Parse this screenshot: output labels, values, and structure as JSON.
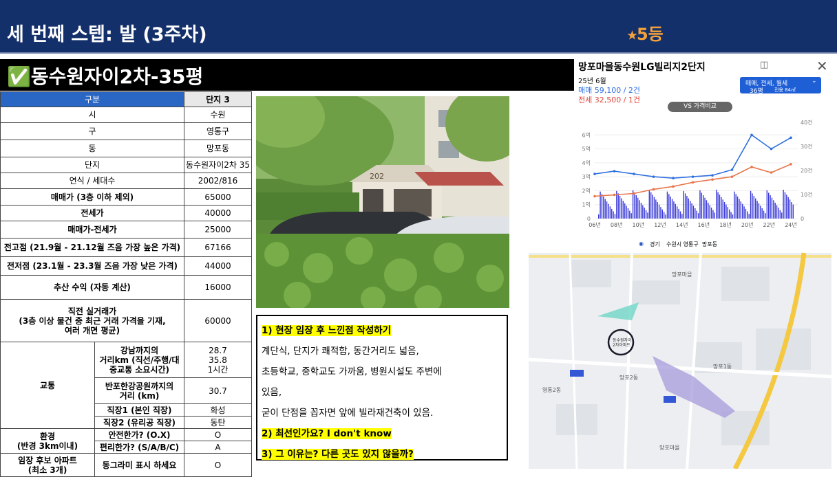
{
  "header": {
    "title": "세 번째 스텝: 발 (3주차)",
    "rating": "⭑5등"
  },
  "subtitle": "✅동수원자이2차-35평",
  "table": {
    "col1": "구분",
    "col2": "단지 3",
    "rows": [
      {
        "label": "시",
        "value": "수원"
      },
      {
        "label": "구",
        "value": "영통구"
      },
      {
        "label": "동",
        "value": "망포동"
      },
      {
        "label": "단지",
        "value": "동수원자이2차 35"
      },
      {
        "label": "연식 / 세대수",
        "value": "2002/816"
      },
      {
        "label": "매매가 (3층 이하 제외)",
        "value": "65000"
      },
      {
        "label": "전세가",
        "value": "40000"
      },
      {
        "label": "매매가-전세가",
        "value": "25000"
      },
      {
        "label": "전고점 (21.9월 - 21.12월 즈음 가장 높은 가격)",
        "value": "67166"
      },
      {
        "label": "전저점 (23.1월 - 23.3월 즈음 가장 낮은 가격)",
        "value": "44000"
      },
      {
        "label": "추산 수익 (자동 계산)",
        "value": "16000"
      },
      {
        "label": "직전 실거래가\n(3층 이상 물건 중 최근 거래 가격을 기재,\n여러 개면 평균)",
        "value": "60000"
      }
    ],
    "transport": {
      "group": "교통",
      "gangnam_label": "강남까지의\n거리km (직선/주행/대\n중교통 소요시간)",
      "gangnam_value": "28.7\n35.8\n1시간",
      "hangang_label": "반포한강공원까지의\n거리 (km)",
      "hangang_value": "30.7",
      "job1_label": "직장1 (본인 직장)",
      "job1_value": "화성",
      "job2_label": "직장2 (유리공 직장)",
      "job2_value": "동탄"
    },
    "env": {
      "group": "환경\n(반경 3km이내)",
      "safe_label": "안전한가? (O.X)",
      "safe_value": "O",
      "conv_label": "편리한가? (S/A/B/C)",
      "conv_value": "A"
    },
    "candidate": {
      "group": "임장 후보 아파트\n(최소 3개)",
      "label": "동그라미 표시 하세요",
      "value": "O"
    }
  },
  "notes": {
    "q1": "1) 현장 임장 후 느낀점 작성하기",
    "body": "계단식, 단지가 쾌적함, 동간거리도 넓음,\n초등학교, 중학교도 가까움, 병원시설도 주변에\n있음,\n굳이 단점을 꼽자면 앞에 빌라재건축이 있음.",
    "q2": "2) 최선인가요? I don't know",
    "q3": "3) 그 이유는? 다른 곳도 있지 않을까?"
  },
  "photo": {
    "sign": "202"
  },
  "chart_panel": {
    "title": "망포마을동수원LG빌리지2단지",
    "month": "25년 6월",
    "sale": "매매 59,100 / 2건",
    "jeonse": "전세 32,500 / 1건",
    "filter": "매매, 전세, 월세",
    "size": "36평",
    "size_sub": "전용 84㎡",
    "vs": "VS 가격비교",
    "colors": {
      "sale": "#2f6fe0",
      "jeonse": "#e8754a",
      "volume": "#3a3ad8"
    }
  },
  "chart_data": {
    "type": "line",
    "x": [
      "06년",
      "08년",
      "10년",
      "12년",
      "14년",
      "16년",
      "18년",
      "20년",
      "22년",
      "24년"
    ],
    "ylabel_left_ticks": [
      "0",
      "1억",
      "2억",
      "3억",
      "4억",
      "5억",
      "6억"
    ],
    "ylabel_right_ticks": [
      "0",
      "10건",
      "20건",
      "30건",
      "40건"
    ],
    "ylim": [
      0,
      7
    ],
    "series": [
      {
        "name": "매매",
        "values": [
          3.2,
          3.4,
          3.2,
          3.0,
          2.9,
          3.0,
          3.1,
          3.5,
          6.0,
          5.0,
          5.8
        ]
      },
      {
        "name": "전세",
        "values": [
          1.6,
          1.7,
          1.8,
          2.1,
          2.3,
          2.6,
          2.8,
          3.0,
          3.7,
          3.3,
          3.9
        ]
      }
    ]
  },
  "map": {
    "nav": [
      "경기",
      "수원시 영통구",
      "망포동"
    ],
    "labels": [
      "망포마을",
      "망포2동",
      "망포1동",
      "영통2동",
      "망포마을"
    ],
    "target": "동수원자이\n2차아파트"
  }
}
